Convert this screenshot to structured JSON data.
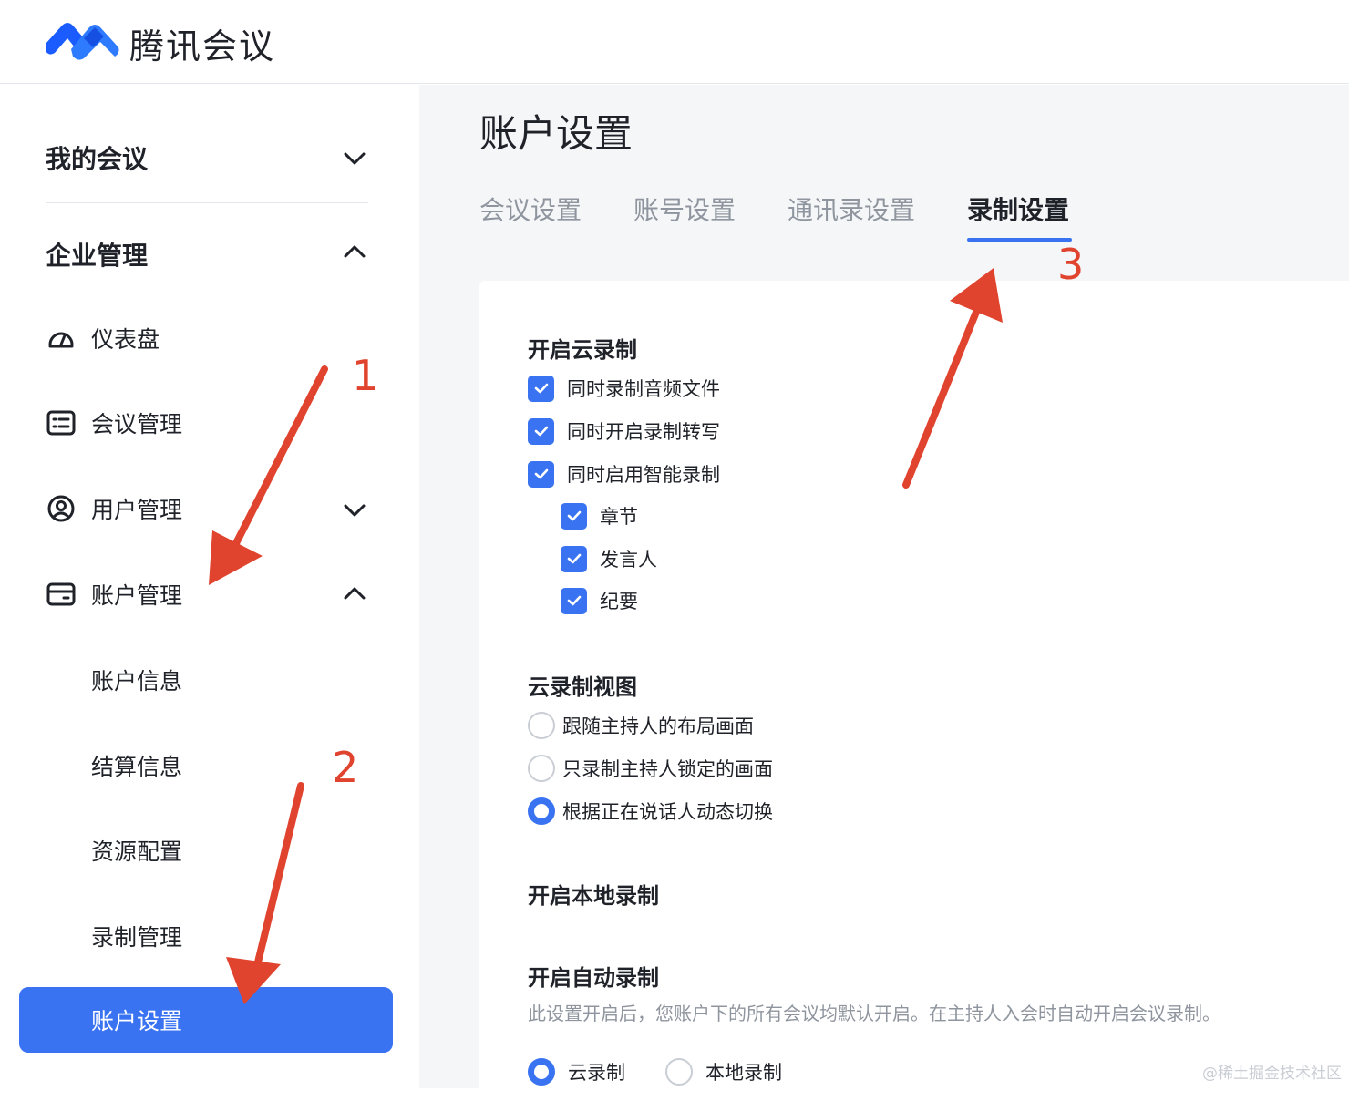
{
  "app": {
    "brand": "腾讯会议"
  },
  "sidebar": {
    "group_my_meetings": "我的会议",
    "group_enterprise": "企业管理",
    "items": [
      {
        "label": "仪表盘",
        "icon": "dashboard-icon"
      },
      {
        "label": "会议管理",
        "icon": "list-icon"
      },
      {
        "label": "用户管理",
        "icon": "user-icon"
      },
      {
        "label": "账户管理",
        "icon": "card-icon"
      }
    ],
    "sub_items": [
      "账户信息",
      "结算信息",
      "资源配置",
      "录制管理",
      "账户设置"
    ],
    "active": "账户设置"
  },
  "main": {
    "page_title": "账户设置",
    "tabs": [
      "会议设置",
      "账号设置",
      "通讯录设置",
      "录制设置"
    ],
    "active_tab": "录制设置",
    "cloud_recording": {
      "title": "开启云录制",
      "options": [
        {
          "label": "同时录制音频文件",
          "checked": true
        },
        {
          "label": "同时开启录制转写",
          "checked": true
        },
        {
          "label": "同时启用智能录制",
          "checked": true
        }
      ],
      "smart_options": [
        {
          "label": "章节",
          "checked": true
        },
        {
          "label": "发言人",
          "checked": true
        },
        {
          "label": "纪要",
          "checked": true
        }
      ]
    },
    "cloud_view": {
      "title": "云录制视图",
      "options": [
        {
          "label": "跟随主持人的布局画面",
          "selected": false
        },
        {
          "label": "只录制主持人锁定的画面",
          "selected": false
        },
        {
          "label": "根据正在说话人动态切换",
          "selected": true
        }
      ]
    },
    "local_recording": {
      "title": "开启本地录制"
    },
    "auto_recording": {
      "title": "开启自动录制",
      "description": "此设置开启后，您账户下的所有会议均默认开启。在主持人入会时自动开启会议录制。",
      "options": [
        {
          "label": "云录制",
          "selected": true
        },
        {
          "label": "本地录制",
          "selected": false
        }
      ]
    }
  },
  "annotations": [
    "1",
    "2",
    "3"
  ],
  "watermark": "@稀土掘金技术社区",
  "colors": {
    "accent": "#3a73f2",
    "annotation": "#e0432e"
  }
}
